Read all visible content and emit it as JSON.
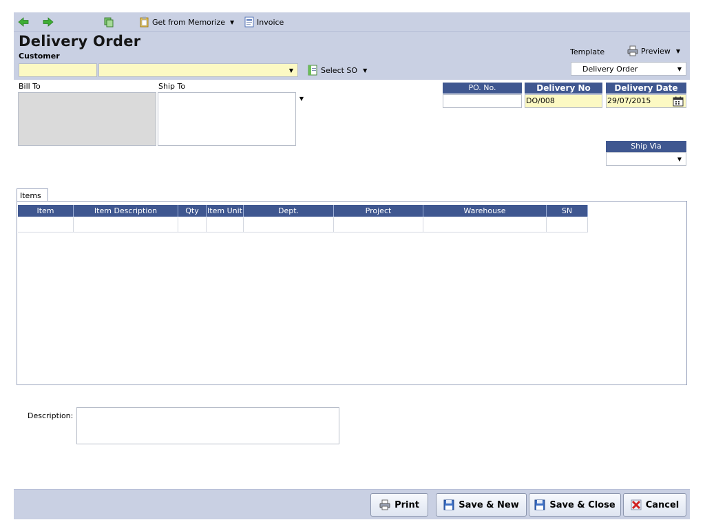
{
  "toolbar": {
    "memorize_label": "Get from Memorize",
    "invoice_label": "Invoice"
  },
  "header": {
    "title": "Delivery Order",
    "customer_label": "Customer",
    "select_so_label": "Select SO",
    "template_label": "Template",
    "preview_label": "Preview",
    "template_value": "Delivery Order"
  },
  "address": {
    "bill_to_label": "Bill To",
    "ship_to_label": "Ship To"
  },
  "order": {
    "po_no_label": "PO. No.",
    "po_no_value": "",
    "delivery_no_label": "Delivery No",
    "delivery_no_value": "DO/008",
    "delivery_date_label": "Delivery Date",
    "delivery_date_value": "29/07/2015",
    "ship_via_label": "Ship Via",
    "ship_via_value": ""
  },
  "items": {
    "tab_label": "Items",
    "columns": [
      "Item",
      "Item Description",
      "Qty",
      "Item Unit",
      "Dept.",
      "Project",
      "Warehouse",
      "SN"
    ]
  },
  "description": {
    "label": "Description:",
    "value": ""
  },
  "footer": {
    "print_label": "Print",
    "save_new_label": "Save & New",
    "save_close_label": "Save & Close",
    "cancel_label": "Cancel"
  },
  "colors": {
    "toolbar_bg": "#c9d0e3",
    "column_header_bg": "#3f5790",
    "required_field_bg": "#fcf9c3",
    "bill_to_bg": "#dadada"
  }
}
